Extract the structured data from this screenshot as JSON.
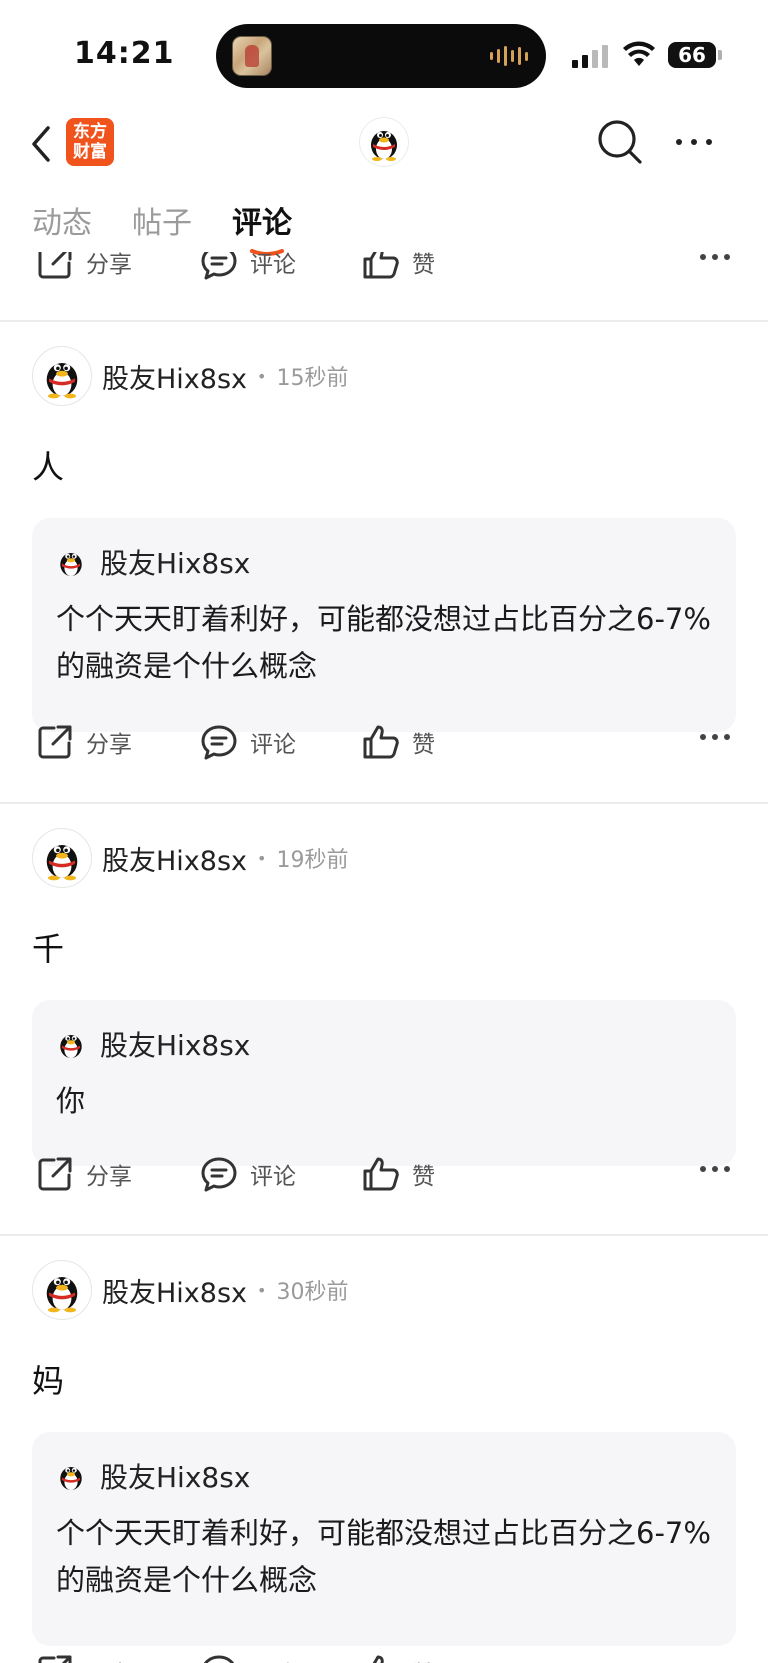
{
  "status": {
    "time": "14:21",
    "battery": "66"
  },
  "nav": {
    "brand_logo_line1": "东方",
    "brand_logo_line2": "财富"
  },
  "tabs": [
    {
      "label": "动态"
    },
    {
      "label": "帖子"
    },
    {
      "label": "评论"
    }
  ],
  "active_tab": "评论",
  "actions": {
    "share": "分享",
    "comment": "评论",
    "like": "赞"
  },
  "posts": [
    {
      "user": "股友Hix8sx",
      "time": "15秒前",
      "content": "人",
      "quote": {
        "user": "股友Hix8sx",
        "text": "个个天天盯着利好，可能都没想过占比百分之6-7%的融资是个什么概念"
      }
    },
    {
      "user": "股友Hix8sx",
      "time": "19秒前",
      "content": "千",
      "quote": {
        "user": "股友Hix8sx",
        "text": "你"
      }
    },
    {
      "user": "股友Hix8sx",
      "time": "30秒前",
      "content": "妈",
      "quote": {
        "user": "股友Hix8sx",
        "text": "个个天天盯着利好，可能都没想过占比百分之6-7%的融资是个什么概念"
      }
    }
  ],
  "colors": {
    "brand": "#f0531c",
    "quote_bg": "#f6f6f8",
    "muted": "#9a9a9a"
  },
  "icons": [
    "back-icon",
    "search-icon",
    "more-icon",
    "share-icon",
    "comment-icon",
    "thumbs-up-icon",
    "qq-penguin-avatar"
  ]
}
